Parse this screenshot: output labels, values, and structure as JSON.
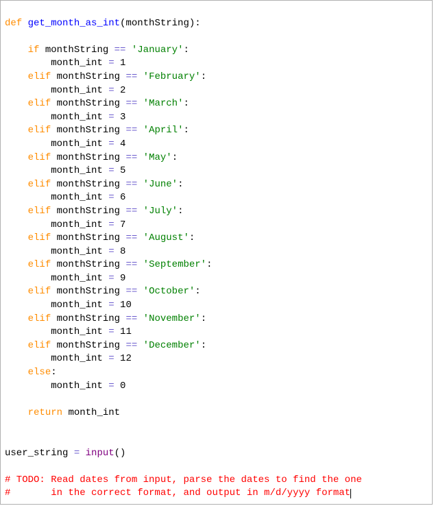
{
  "code": {
    "line01": {
      "def": "def ",
      "fn": "get_month_as_int",
      "paren_open": "(",
      "param": "monthString",
      "paren_close": ")",
      "colon": ":"
    },
    "line02": "",
    "line03": {
      "indent": "    ",
      "kw": "if",
      "sp": " ",
      "var": "monthString ",
      "op": "==",
      "sp2": " ",
      "str": "'January'",
      "colon": ":"
    },
    "line04": {
      "indent": "        ",
      "var": "month_int ",
      "op": "=",
      "sp": " ",
      "val": "1"
    },
    "line05": {
      "indent": "    ",
      "kw": "elif",
      "sp": " ",
      "var": "monthString ",
      "op": "==",
      "sp2": " ",
      "str": "'February'",
      "colon": ":"
    },
    "line06": {
      "indent": "        ",
      "var": "month_int ",
      "op": "=",
      "sp": " ",
      "val": "2"
    },
    "line07": {
      "indent": "    ",
      "kw": "elif",
      "sp": " ",
      "var": "monthString ",
      "op": "==",
      "sp2": " ",
      "str": "'March'",
      "colon": ":"
    },
    "line08": {
      "indent": "        ",
      "var": "month_int ",
      "op": "=",
      "sp": " ",
      "val": "3"
    },
    "line09": {
      "indent": "    ",
      "kw": "elif",
      "sp": " ",
      "var": "monthString ",
      "op": "==",
      "sp2": " ",
      "str": "'April'",
      "colon": ":"
    },
    "line10": {
      "indent": "        ",
      "var": "month_int ",
      "op": "=",
      "sp": " ",
      "val": "4"
    },
    "line11": {
      "indent": "    ",
      "kw": "elif",
      "sp": " ",
      "var": "monthString ",
      "op": "==",
      "sp2": " ",
      "str": "'May'",
      "colon": ":"
    },
    "line12": {
      "indent": "        ",
      "var": "month_int ",
      "op": "=",
      "sp": " ",
      "val": "5"
    },
    "line13": {
      "indent": "    ",
      "kw": "elif",
      "sp": " ",
      "var": "monthString ",
      "op": "==",
      "sp2": " ",
      "str": "'June'",
      "colon": ":"
    },
    "line14": {
      "indent": "        ",
      "var": "month_int ",
      "op": "=",
      "sp": " ",
      "val": "6"
    },
    "line15": {
      "indent": "    ",
      "kw": "elif",
      "sp": " ",
      "var": "monthString ",
      "op": "==",
      "sp2": " ",
      "str": "'July'",
      "colon": ":"
    },
    "line16": {
      "indent": "        ",
      "var": "month_int ",
      "op": "=",
      "sp": " ",
      "val": "7"
    },
    "line17": {
      "indent": "    ",
      "kw": "elif",
      "sp": " ",
      "var": "monthString ",
      "op": "==",
      "sp2": " ",
      "str": "'August'",
      "colon": ":"
    },
    "line18": {
      "indent": "        ",
      "var": "month_int ",
      "op": "=",
      "sp": " ",
      "val": "8"
    },
    "line19": {
      "indent": "    ",
      "kw": "elif",
      "sp": " ",
      "var": "monthString ",
      "op": "==",
      "sp2": " ",
      "str": "'September'",
      "colon": ":"
    },
    "line20": {
      "indent": "        ",
      "var": "month_int ",
      "op": "=",
      "sp": " ",
      "val": "9"
    },
    "line21": {
      "indent": "    ",
      "kw": "elif",
      "sp": " ",
      "var": "monthString ",
      "op": "==",
      "sp2": " ",
      "str": "'October'",
      "colon": ":"
    },
    "line22": {
      "indent": "        ",
      "var": "month_int ",
      "op": "=",
      "sp": " ",
      "val": "10"
    },
    "line23": {
      "indent": "    ",
      "kw": "elif",
      "sp": " ",
      "var": "monthString ",
      "op": "==",
      "sp2": " ",
      "str": "'November'",
      "colon": ":"
    },
    "line24": {
      "indent": "        ",
      "var": "month_int ",
      "op": "=",
      "sp": " ",
      "val": "11"
    },
    "line25": {
      "indent": "    ",
      "kw": "elif",
      "sp": " ",
      "var": "monthString ",
      "op": "==",
      "sp2": " ",
      "str": "'December'",
      "colon": ":"
    },
    "line26": {
      "indent": "        ",
      "var": "month_int ",
      "op": "=",
      "sp": " ",
      "val": "12"
    },
    "line27": {
      "indent": "    ",
      "kw": "else",
      "colon": ":"
    },
    "line28": {
      "indent": "        ",
      "var": "month_int ",
      "op": "=",
      "sp": " ",
      "val": "0"
    },
    "line29": "",
    "line30": {
      "indent": "    ",
      "kw": "return",
      "sp": " ",
      "var": "month_int"
    },
    "line31": "",
    "line32": "",
    "line33": {
      "var": "user_string ",
      "op": "=",
      "sp": " ",
      "fn": "input",
      "paren": "()"
    },
    "line34": "",
    "line35": "# TODO: Read dates from input, parse the dates to find the one",
    "line36": "#       in the correct format, and output in m/d/yyyy format"
  }
}
